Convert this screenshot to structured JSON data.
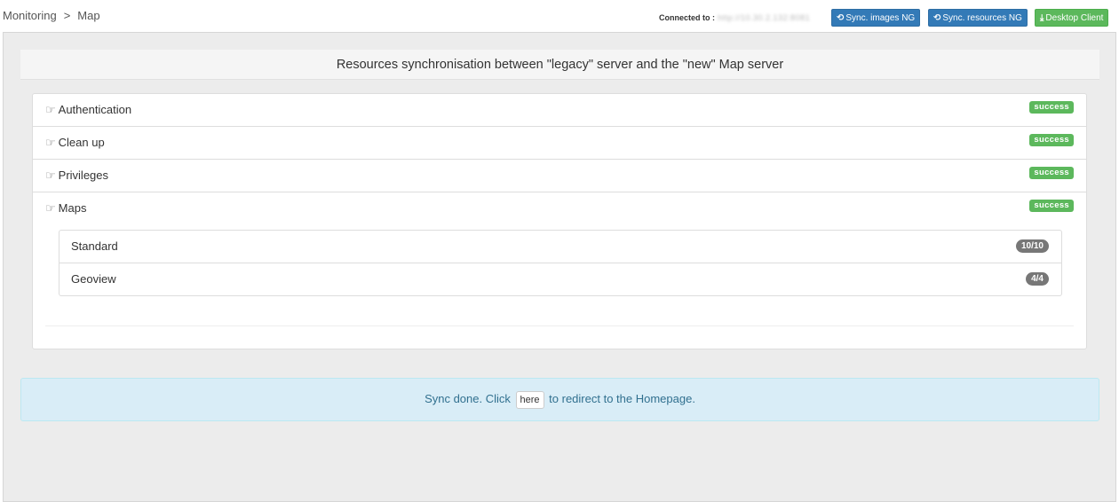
{
  "breadcrumb": {
    "root": "Monitoring",
    "separator": ">",
    "current": "Map"
  },
  "connection": {
    "label": "Connected to :",
    "url": "http://10.30.2.132:8081"
  },
  "toolbar": {
    "sync_images": {
      "icon": "refresh-icon",
      "icon_glyph": "⟲",
      "label": "Sync. images NG",
      "color": "#337ab7"
    },
    "sync_resources": {
      "icon": "refresh-icon",
      "icon_glyph": "⟲",
      "label": "Sync. resources NG",
      "color": "#337ab7"
    },
    "desktop_client": {
      "icon": "download-icon",
      "icon_glyph": "⤓",
      "label": "Desktop Client",
      "color": "#5cb85c"
    }
  },
  "panel": {
    "title": "Resources synchronisation between \"legacy\" server and the \"new\" Map server"
  },
  "steps": [
    {
      "icon": "hand-pointer-icon",
      "icon_glyph": "☞",
      "label": "Authentication",
      "status": "success"
    },
    {
      "icon": "hand-pointer-icon",
      "icon_glyph": "☞",
      "label": "Clean up",
      "status": "success"
    },
    {
      "icon": "hand-pointer-icon",
      "icon_glyph": "☞",
      "label": "Privileges",
      "status": "success"
    },
    {
      "icon": "hand-pointer-icon",
      "icon_glyph": "☞",
      "label": "Maps",
      "status": "success"
    }
  ],
  "maps": [
    {
      "name": "Standard",
      "count": "10/10"
    },
    {
      "name": "Geoview",
      "count": "4/4"
    }
  ],
  "alert": {
    "prefix": "Sync done. Click",
    "button": "here",
    "suffix": "to redirect to the Homepage."
  },
  "colors": {
    "success": "#5cb85c",
    "primary": "#337ab7",
    "info_bg": "#d9edf7",
    "info_text": "#31708f",
    "badge": "#777777"
  }
}
